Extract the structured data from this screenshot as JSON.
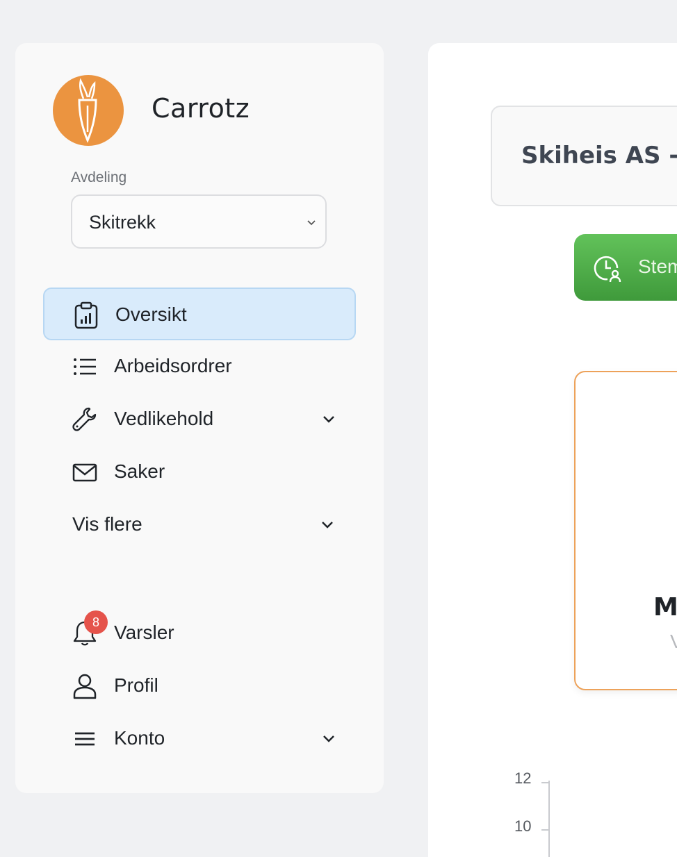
{
  "app": {
    "name": "Carrotz"
  },
  "department": {
    "label": "Avdeling",
    "selected": "Skitrekk"
  },
  "nav": {
    "items": [
      {
        "label": "Oversikt",
        "icon": "clipboard-chart-icon",
        "active": true
      },
      {
        "label": "Arbeidsordrer",
        "icon": "list-icon"
      },
      {
        "label": "Vedlikehold",
        "icon": "wrench-icon",
        "expandable": true
      },
      {
        "label": "Saker",
        "icon": "mail-icon"
      },
      {
        "label": "Vis flere",
        "expandable": true
      }
    ],
    "bottom": [
      {
        "label": "Varsler",
        "icon": "bell-icon",
        "badge": "8"
      },
      {
        "label": "Profil",
        "icon": "user-icon"
      },
      {
        "label": "Konto",
        "icon": "menu-icon",
        "expandable": true
      }
    ]
  },
  "main": {
    "title": "Skiheis AS -",
    "action_button": "Stem",
    "card": {
      "heading": "M",
      "subtext": "V"
    },
    "chart": {
      "y_ticks": [
        "12",
        "10"
      ]
    }
  },
  "colors": {
    "brand": "#eb9440",
    "active_bg": "#d9ebfb",
    "green": "#4cae47",
    "badge": "#e5534b"
  }
}
